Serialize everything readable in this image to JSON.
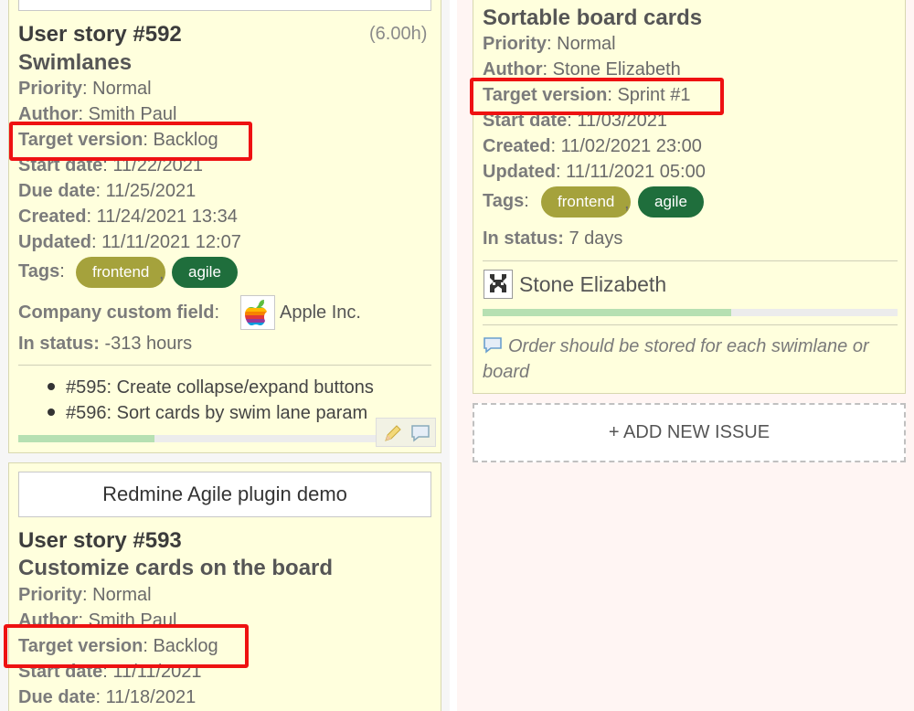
{
  "card_592": {
    "hours": "(6.00h)",
    "title": "User story #592",
    "subject": "Swimlanes",
    "priority_label": "Priority",
    "priority": "Normal",
    "author_label": "Author",
    "author": "Smith Paul",
    "target_label": "Target version",
    "target": "Backlog",
    "start_label": "Start date",
    "start": "11/22/2021",
    "due_label": "Due date",
    "due": "11/25/2021",
    "created_label": "Created",
    "created": "11/24/2021 13:34",
    "updated_label": "Updated",
    "updated": "11/11/2021 12:07",
    "tags_label": "Tags",
    "tags": [
      "frontend",
      "agile"
    ],
    "company_label": "Company custom field",
    "company": "Apple Inc.",
    "in_status_label": "In status:",
    "in_status": "-313 hours",
    "subtasks": [
      "#595: Create collapse/expand buttons",
      "#596: Sort cards by swim lane param"
    ],
    "progress": 0.33
  },
  "card_593": {
    "project": "Redmine Agile plugin demo",
    "title": "User story #593",
    "subject": "Customize cards on the board",
    "priority_label": "Priority",
    "priority": "Normal",
    "author_label": "Author",
    "author": "Smith Paul",
    "target_label": "Target version",
    "target": "Backlog",
    "start_label": "Start date",
    "start": "11/11/2021",
    "due_label": "Due date",
    "due": "11/18/2021"
  },
  "card_right": {
    "subject": "Sortable board cards",
    "priority_label": "Priority",
    "priority": "Normal",
    "author_label": "Author",
    "author": "Stone Elizabeth",
    "target_label": "Target version",
    "target": "Sprint #1",
    "start_label": "Start date",
    "start": "11/03/2021",
    "created_label": "Created",
    "created": "11/02/2021 23:00",
    "updated_label": "Updated",
    "updated": "11/11/2021 05:00",
    "tags_label": "Tags",
    "tags": [
      "frontend",
      "agile"
    ],
    "in_status_label": "In status:",
    "in_status": "7 days",
    "assignee": "Stone Elizabeth",
    "progress": 0.6,
    "comment": "Order should be stored for each swimlane or board"
  },
  "add_issue_label": "+ ADD NEW ISSUE",
  "colors": {
    "highlight": "#ee1111",
    "card_bg": "#ffffdd",
    "tag_frontend": "#a5a23c",
    "tag_agile": "#1f6e3c"
  }
}
